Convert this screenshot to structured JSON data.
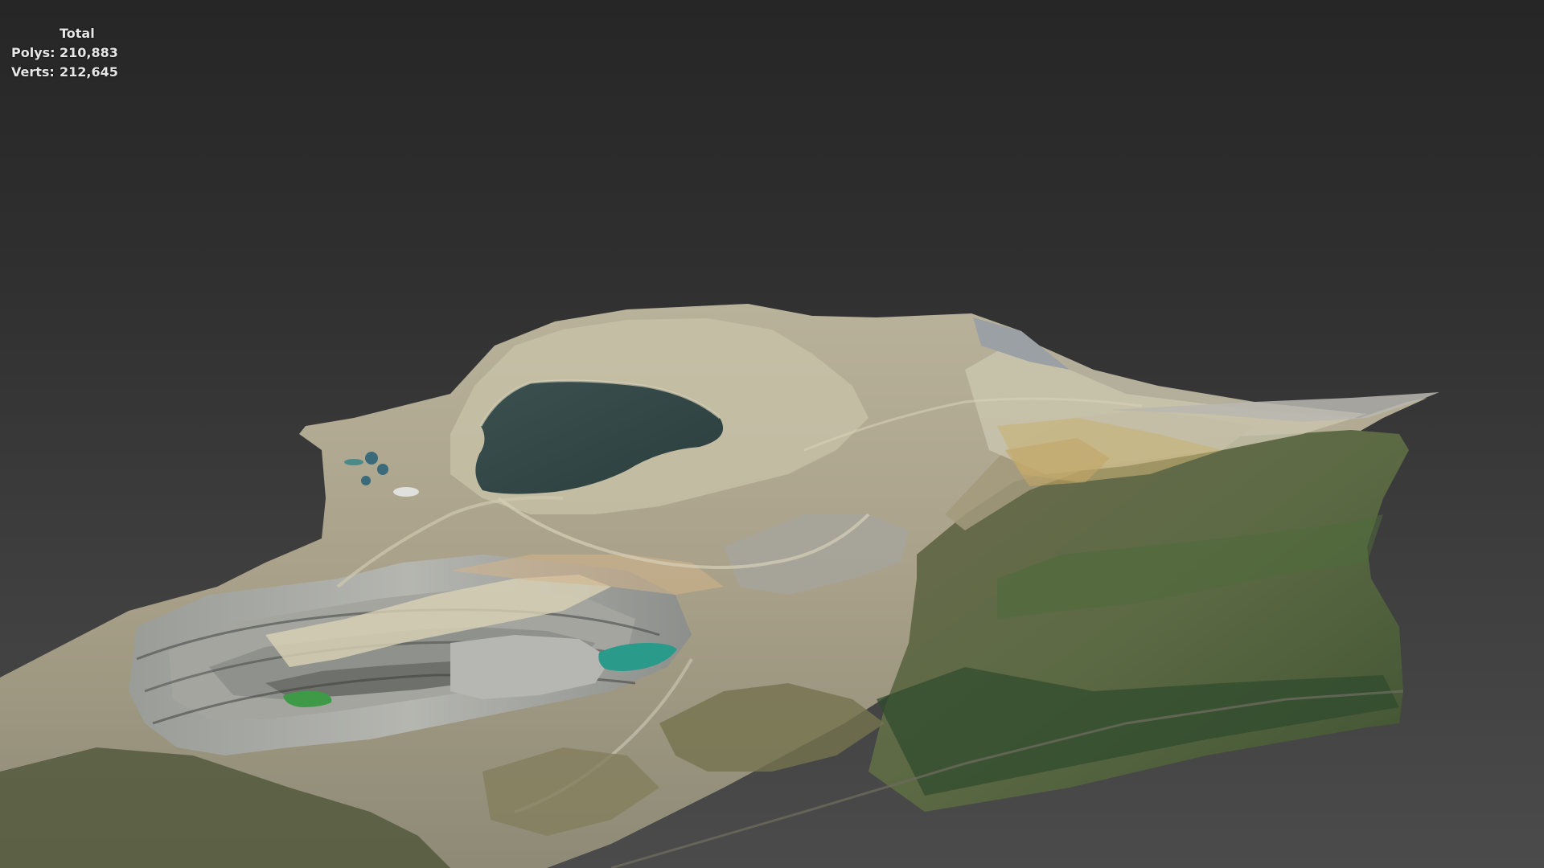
{
  "viewport": {
    "stats": {
      "header": "Total",
      "polys_label": "Polys:",
      "polys_value": "210,883",
      "verts_label": "Verts:",
      "verts_value": "212,645"
    },
    "background_color_top": "#262626",
    "background_color_bottom": "#4b4b4b"
  }
}
